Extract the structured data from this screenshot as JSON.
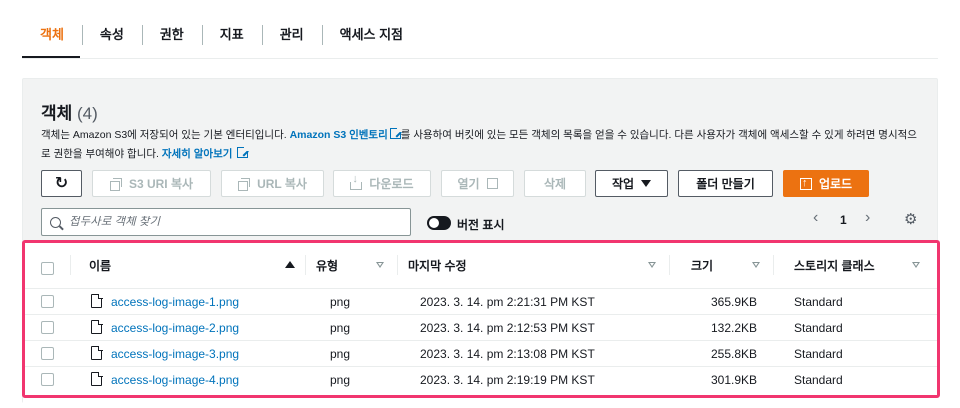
{
  "tabs": [
    {
      "label": "객체",
      "active": true
    },
    {
      "label": "속성"
    },
    {
      "label": "권한"
    },
    {
      "label": "지표"
    },
    {
      "label": "관리"
    },
    {
      "label": "액세스 지점"
    }
  ],
  "panel": {
    "title": "객체",
    "count": "(4)",
    "description": {
      "part1": "객체는 Amazon S3에 저장되어 있는 기본 엔터티입니다. ",
      "link1": "Amazon S3 인벤토리",
      "part2": "를 사용하여 버킷에 있는 모든 객체의 목록을 얻을 수 있습니다. 다른 사용자가 객체에 액세스할 수 있게 하려면 명시적으로 권한을 부여해야 합니다. ",
      "link2": "자세히 알아보기"
    }
  },
  "toolbar": {
    "refresh": "refresh-icon",
    "copy_s3_uri": "S3 URI 복사",
    "copy_url": "URL 복사",
    "download": "다운로드",
    "open": "열기",
    "delete": "삭제",
    "actions": "작업",
    "create_folder": "폴더 만들기",
    "upload": "업로드"
  },
  "search": {
    "placeholder": "접두사로 객체 찾기"
  },
  "versions_toggle": {
    "label": "버전 표시"
  },
  "pagination": {
    "page": "1"
  },
  "table": {
    "headers": {
      "name": "이름",
      "type": "유형",
      "modified": "마지막 수정",
      "size": "크기",
      "storage_class": "스토리지 클래스"
    },
    "rows": [
      {
        "name": "access-log-image-1.png",
        "type": "png",
        "modified": "2023. 3. 14. pm 2:21:31 PM KST",
        "size": "365.9KB",
        "storage_class": "Standard"
      },
      {
        "name": "access-log-image-2.png",
        "type": "png",
        "modified": "2023. 3. 14. pm 2:12:53 PM KST",
        "size": "132.2KB",
        "storage_class": "Standard"
      },
      {
        "name": "access-log-image-3.png",
        "type": "png",
        "modified": "2023. 3. 14. pm 2:13:08 PM KST",
        "size": "255.8KB",
        "storage_class": "Standard"
      },
      {
        "name": "access-log-image-4.png",
        "type": "png",
        "modified": "2023. 3. 14. pm 2:19:19 PM KST",
        "size": "301.9KB",
        "storage_class": "Standard"
      }
    ]
  },
  "colors": {
    "accent": "#ec7211",
    "link": "#0073bb",
    "highlight": "#f1356f"
  }
}
